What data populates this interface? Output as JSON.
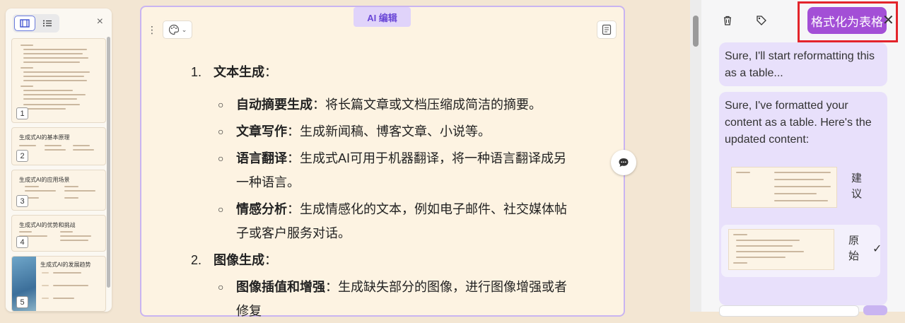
{
  "sidebar": {
    "view_toggle": {
      "active": "thumbnails-icon",
      "other": "list-icon"
    },
    "close_label": "×",
    "pages": [
      {
        "num": "1",
        "title": ""
      },
      {
        "num": "2",
        "title": "生成式AI的基本原理"
      },
      {
        "num": "3",
        "title": "生成式AI的应用场景"
      },
      {
        "num": "4",
        "title": "生成式AI的优势和挑战"
      },
      {
        "num": "5",
        "title": "生成式AI的发展趋势"
      }
    ]
  },
  "document": {
    "ai_tab": "AI 编辑",
    "toolbar": {
      "menu_icon": "more-vert-icon",
      "palette_icon": "palette-icon",
      "notes_icon": "notes-icon"
    },
    "items": [
      {
        "marker": "1.",
        "title": "文本生成",
        "suffix": "："
      },
      {
        "bullet": "○",
        "title": "自动摘要生成",
        "text": "：将长篇文章或文档压缩成简洁的摘要。"
      },
      {
        "bullet": "○",
        "title": "文章写作",
        "text": "：生成新闻稿、博客文章、小说等。"
      },
      {
        "bullet": "○",
        "title": "语言翻译",
        "text": "：生成式AI可用于机器翻译，将一种语言翻译成另一种语言。"
      },
      {
        "bullet": "○",
        "title": "情感分析",
        "text": "：生成情感化的文本，例如电子邮件、社交媒体帖子或客户服务对话。"
      },
      {
        "marker": "2.",
        "title": "图像生成",
        "suffix": "："
      },
      {
        "bullet": "○",
        "title": "图像插值和增强",
        "text": "：生成缺失部分的图像，进行图像增强或者修复"
      }
    ]
  },
  "ai_panel": {
    "format_button": "格式化为表格",
    "close": "✕",
    "messages": [
      "Sure, I'll start reformatting this as a table...",
      "Sure, I've formatted your content as a table. Here's the updated content:"
    ],
    "options": [
      {
        "label": "建议",
        "selected": false
      },
      {
        "label": "原始",
        "selected": true
      }
    ],
    "check": "✓"
  }
}
